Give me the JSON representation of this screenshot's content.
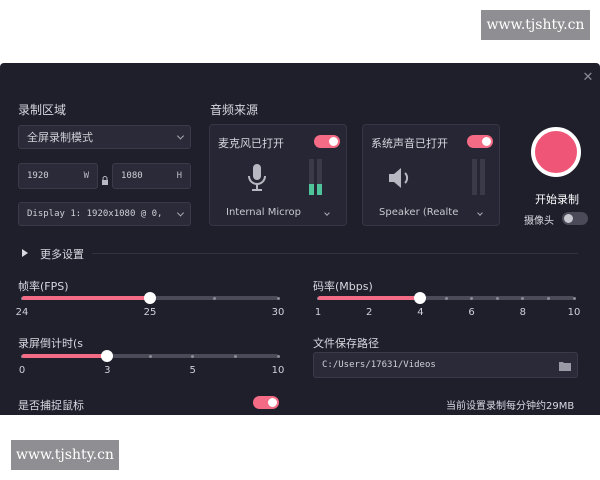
{
  "watermark": {
    "text": "www.tjshty.cn"
  },
  "window": {
    "close_glyph": "✕"
  },
  "record_area": {
    "title": "录制区域",
    "mode": "全屏录制模式",
    "width": "1920",
    "width_unit": "W",
    "height": "1080",
    "height_unit": "H",
    "display": "Display 1: 1920x1080 @ 0,"
  },
  "audio": {
    "title": "音频来源",
    "mic": {
      "label": "麦克风已打开",
      "device": "Internal Microp",
      "on": true,
      "icon": "microphone-icon"
    },
    "system": {
      "label": "系统声音已打开",
      "device": "Speaker (Realte",
      "on": true,
      "icon": "speaker-icon"
    }
  },
  "record": {
    "start_label": "开始录制",
    "camera_label": "摄像头",
    "camera_on": false
  },
  "more_settings": "更多设置",
  "fps": {
    "label": "帧率(FPS)",
    "ticks": [
      "24",
      "25",
      "30"
    ],
    "value": 25
  },
  "bitrate": {
    "label": "码率(Mbps)",
    "ticks": [
      "1",
      "2",
      "4",
      "6",
      "8",
      "10"
    ],
    "value": 4
  },
  "countdown": {
    "label": "录屏倒计时(s",
    "ticks": [
      "0",
      "3",
      "5",
      "10"
    ],
    "value": 3
  },
  "save_path": {
    "label": "文件保存路径",
    "value": "C:/Users/17631/Videos"
  },
  "capture_mouse": {
    "label": "是否捕捉鼠标",
    "on": true
  },
  "size_estimate": "当前设置录制每分钟约29MB",
  "colors": {
    "accent": "#f36b85",
    "background": "#1f1f2c",
    "panel": "#262634"
  }
}
